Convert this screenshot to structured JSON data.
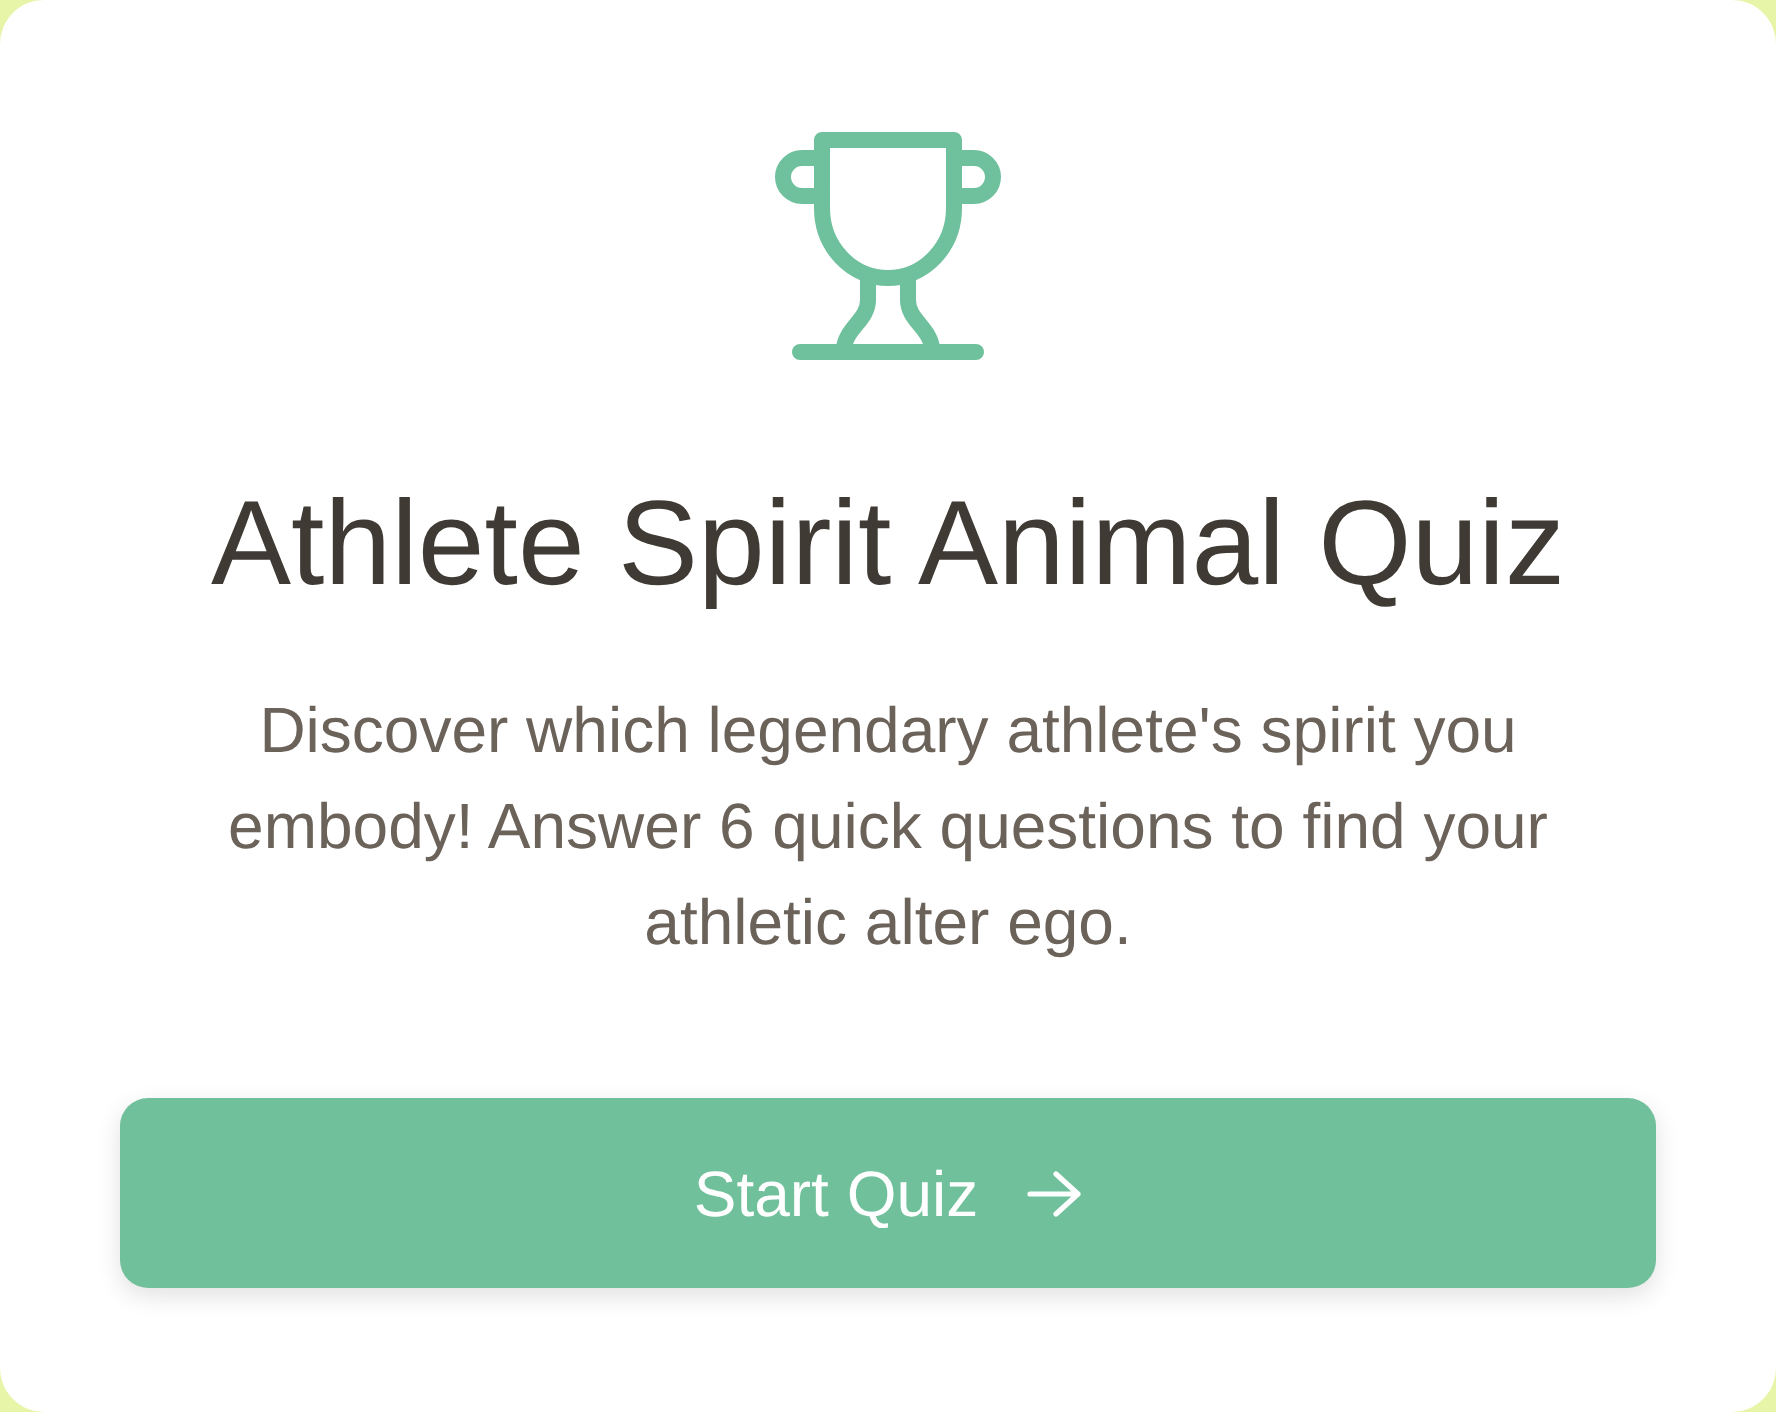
{
  "quiz": {
    "title": "Athlete Spirit Animal Quiz",
    "description": "Discover which legendary athlete's spirit you embody! Answer 6 quick questions to find your athletic alter ego.",
    "start_button": {
      "label": "Start Quiz"
    }
  }
}
